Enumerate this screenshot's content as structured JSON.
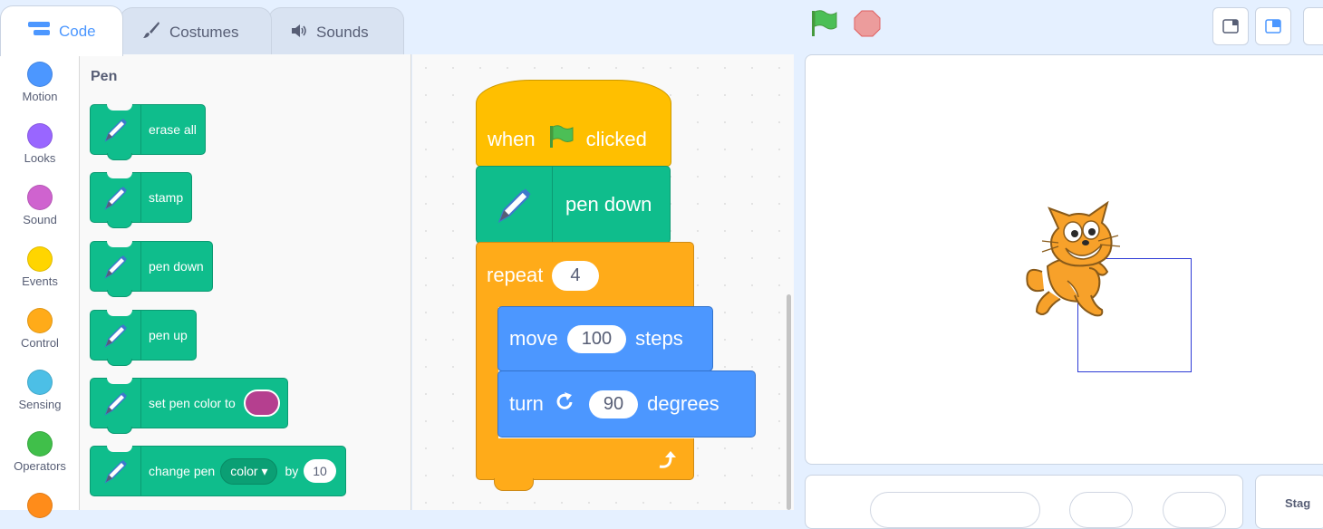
{
  "tabs": [
    {
      "label": "Code",
      "icon": "code-icon",
      "active": true
    },
    {
      "label": "Costumes",
      "icon": "brush-icon",
      "active": false
    },
    {
      "label": "Sounds",
      "icon": "speaker-icon",
      "active": false
    }
  ],
  "categories": [
    {
      "label": "Motion",
      "color": "#4c97ff"
    },
    {
      "label": "Looks",
      "color": "#9966ff"
    },
    {
      "label": "Sound",
      "color": "#cf63cf"
    },
    {
      "label": "Events",
      "color": "#ffd500"
    },
    {
      "label": "Control",
      "color": "#ffab19"
    },
    {
      "label": "Sensing",
      "color": "#4cbfe6"
    },
    {
      "label": "Operators",
      "color": "#40bf4a"
    },
    {
      "label": "",
      "color": "#ff8c1a"
    }
  ],
  "palette": {
    "title": "Pen",
    "blocks": {
      "erase_all": "erase all",
      "stamp": "stamp",
      "pen_down": "pen down",
      "pen_up": "pen up",
      "set_pen_color": "set pen color to",
      "change_pen": "change pen",
      "change_pen_param": "color",
      "change_pen_by": "by",
      "change_pen_value": "10"
    },
    "pen_color": "#b53f8f"
  },
  "script": {
    "hat_when": "when",
    "hat_clicked": "clicked",
    "pen_down": "pen down",
    "repeat": "repeat",
    "repeat_count": "4",
    "move": "move",
    "move_steps": "100",
    "steps": "steps",
    "turn": "turn",
    "turn_degrees": "90",
    "degrees": "degrees"
  },
  "stage": {
    "label": "Stag",
    "pen_trail_color": "#2e3bd6"
  },
  "colors": {
    "pen_green": "#0fbd8c",
    "events_yellow": "#ffbf00",
    "control_orange": "#ffab19",
    "motion_blue": "#4c97ff",
    "accent": "#4c97ff"
  }
}
